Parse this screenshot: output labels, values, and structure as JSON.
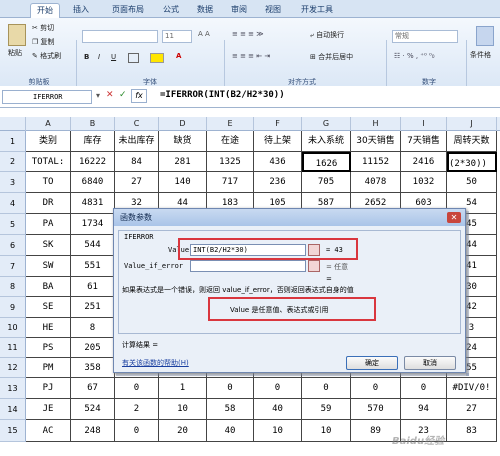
{
  "ribbon_tabs": [
    "开始",
    "插入",
    "页面布局",
    "公式",
    "数据",
    "审阅",
    "视图",
    "开发工具"
  ],
  "clipboard": {
    "paste": "粘贴",
    "cut": "剪切",
    "copy": "复制",
    "painter": "格式刷",
    "group": "剪贴板"
  },
  "font": {
    "name": "",
    "size": "11",
    "group": "字体"
  },
  "align": {
    "wrap": "自动换行",
    "merge": "合并后居中",
    "group": "对齐方式"
  },
  "number": {
    "format": "常规",
    "group": "数字"
  },
  "styles": {
    "label": "条件格"
  },
  "formula_bar": {
    "name_box": "IFERROR",
    "fx": "fx",
    "formula": "=IFERROR(INT(B2/H2*30))"
  },
  "columns": [
    "A",
    "B",
    "C",
    "D",
    "E",
    "F",
    "G",
    "H",
    "I",
    "J"
  ],
  "rows": [
    [
      "类别",
      "库存",
      "未出库存",
      "缺货",
      "在途",
      "待上架",
      "未入系统",
      "30天销售",
      "7天销售",
      "周转天数"
    ],
    [
      "TOTAL:",
      "16222",
      "84",
      "281",
      "1325",
      "436",
      "1626",
      "11152",
      "2416",
      "(2*30))"
    ],
    [
      "TO",
      "6840",
      "27",
      "140",
      "717",
      "236",
      "705",
      "4078",
      "1032",
      "50"
    ],
    [
      "DR",
      "4831",
      "32",
      "44",
      "183",
      "105",
      "587",
      "2652",
      "603",
      "54"
    ],
    [
      "PA",
      "1734",
      "",
      "",
      "",
      "",
      "",
      "",
      "",
      "45"
    ],
    [
      "SK",
      "544",
      "",
      "",
      "",
      "",
      "",
      "",
      "",
      "44"
    ],
    [
      "SW",
      "551",
      "",
      "",
      "",
      "",
      "",
      "",
      "",
      "41"
    ],
    [
      "BA",
      "61",
      "",
      "",
      "",
      "",
      "",
      "",
      "",
      "30"
    ],
    [
      "SE",
      "251",
      "",
      "",
      "",
      "",
      "",
      "",
      "",
      "42"
    ],
    [
      "HE",
      "8",
      "",
      "",
      "",
      "",
      "",
      "",
      "",
      "3"
    ],
    [
      "PS",
      "205",
      "",
      "",
      "",
      "",
      "",
      "",
      "",
      "24"
    ],
    [
      "PM",
      "358",
      "",
      "",
      "",
      "",
      "",
      "",
      "",
      "55"
    ],
    [
      "PJ",
      "67",
      "0",
      "1",
      "0",
      "0",
      "0",
      "0",
      "0",
      "#DIV/0!"
    ],
    [
      "JE",
      "524",
      "2",
      "10",
      "58",
      "40",
      "59",
      "570",
      "94",
      "27"
    ],
    [
      "AC",
      "248",
      "0",
      "20",
      "40",
      "10",
      "10",
      "89",
      "23",
      "83"
    ]
  ],
  "dialog": {
    "title": "函数参数",
    "func": "IFERROR",
    "arg1_label": "Value",
    "arg1_value": "INT(B2/H2*30)",
    "arg1_result": "= 43",
    "arg2_label": "Value_if_error",
    "arg2_result": "= 任意",
    "equals": "=",
    "desc1": "如果表达式是一个错误，则返回 value_if_error，否则返回表达式自身的值",
    "desc2": "Value  是任意值、表达式或引用",
    "calc": "计算结果 =",
    "help": "有关该函数的帮助(H)",
    "ok": "确定",
    "cancel": "取消"
  },
  "watermark": "Baidu经验"
}
